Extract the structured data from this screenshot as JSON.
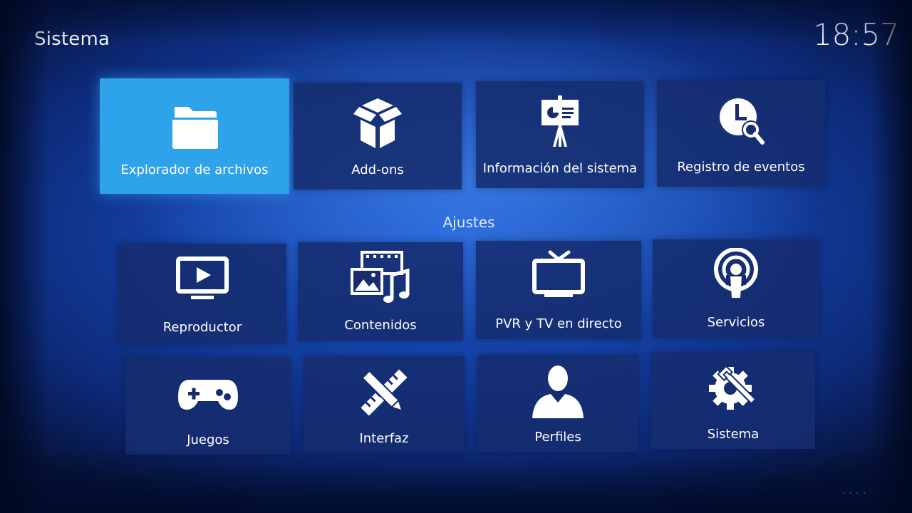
{
  "header": {
    "title": "Sistema",
    "clock": "18:57"
  },
  "top_row": [
    {
      "label": "Explorador de archivos",
      "icon": "folder-icon",
      "focused": true
    },
    {
      "label": "Add-ons",
      "icon": "box-icon"
    },
    {
      "label": "Información del sistema",
      "icon": "presentation-icon"
    },
    {
      "label": "Registro de eventos",
      "icon": "clock-search-icon"
    }
  ],
  "section": {
    "title": "Ajustes"
  },
  "settings": [
    {
      "label": "Reproductor",
      "icon": "play-monitor-icon"
    },
    {
      "label": "Contenidos",
      "icon": "media-icon"
    },
    {
      "label": "PVR y TV en directo",
      "icon": "tv-icon"
    },
    {
      "label": "Servicios",
      "icon": "broadcast-icon"
    },
    {
      "label": "Juegos",
      "icon": "gamepad-icon"
    },
    {
      "label": "Interfaz",
      "icon": "pencil-ruler-icon"
    },
    {
      "label": "Perfiles",
      "icon": "person-icon"
    },
    {
      "label": "Sistema",
      "icon": "gear-wrench-icon"
    }
  ],
  "footer": {
    "dots": "...."
  },
  "colors": {
    "focus": "#2fa3ea",
    "tile": "#162c6e",
    "background": "#1443a8"
  }
}
